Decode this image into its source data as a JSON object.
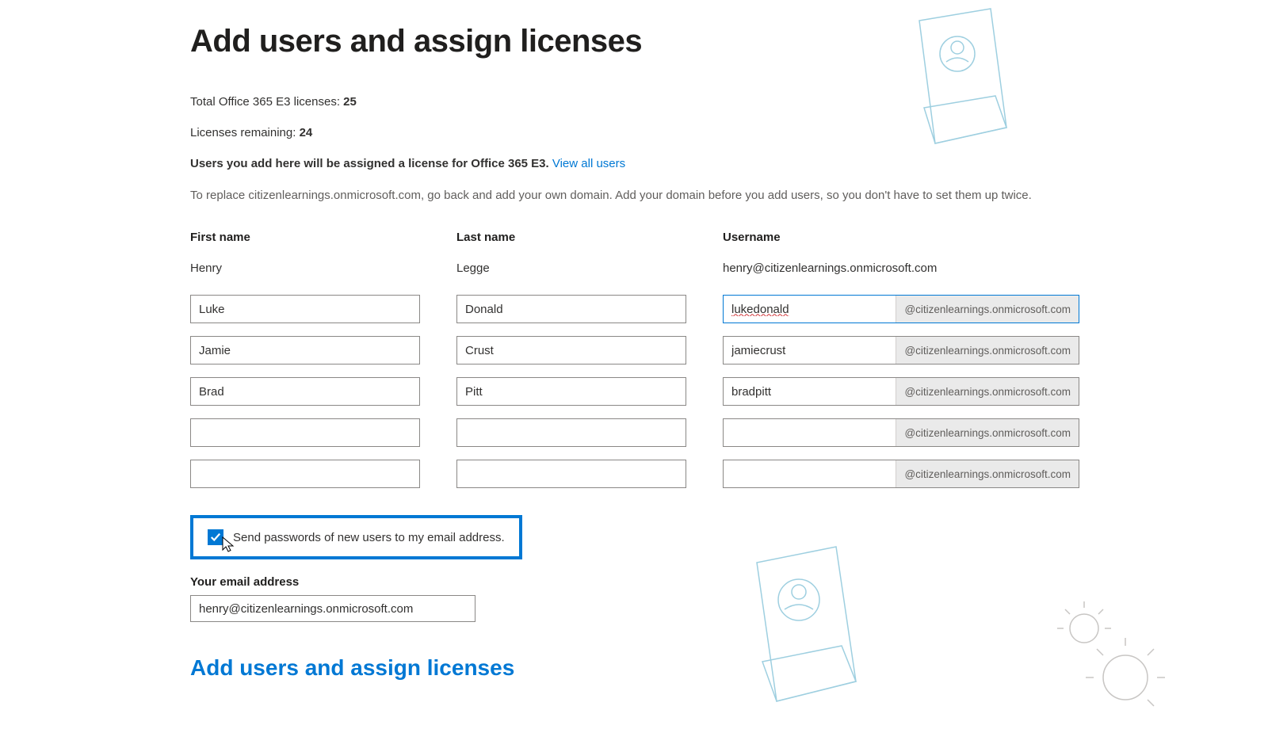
{
  "page_title": "Add users and assign licenses",
  "license_block": {
    "total_label": "Total Office 365 E3 licenses: ",
    "total_value": "25",
    "remaining_label": "Licenses remaining: ",
    "remaining_value": "24",
    "assign_text": "Users you add here will be assigned a license for Office 365 E3. ",
    "view_all_link": "View all users"
  },
  "domain_hint": "To replace citizenlearnings.onmicrosoft.com, go back and add your own domain. Add your domain before you add users, so you don't have to set them up twice.",
  "columns": {
    "first_name": "First name",
    "last_name": "Last name",
    "username": "Username"
  },
  "existing_user": {
    "first_name": "Henry",
    "last_name": "Legge",
    "username": "henry@citizenlearnings.onmicrosoft.com"
  },
  "domain_suffix": "@citizenlearnings.onmicrosoft.com",
  "rows": [
    {
      "first": "Luke",
      "last": "Donald",
      "user": "lukedonald"
    },
    {
      "first": "Jamie",
      "last": "Crust",
      "user": "jamiecrust"
    },
    {
      "first": "Brad",
      "last": "Pitt",
      "user": "bradpitt"
    },
    {
      "first": "",
      "last": "",
      "user": ""
    },
    {
      "first": "",
      "last": "",
      "user": ""
    }
  ],
  "send_passwords": {
    "checked": true,
    "label": "Send passwords of new users to my email address."
  },
  "email_section": {
    "label": "Your email address",
    "value": "henry@citizenlearnings.onmicrosoft.com"
  },
  "section_title_bottom": "Add users and assign licenses",
  "colors": {
    "accent": "#0078d4"
  }
}
